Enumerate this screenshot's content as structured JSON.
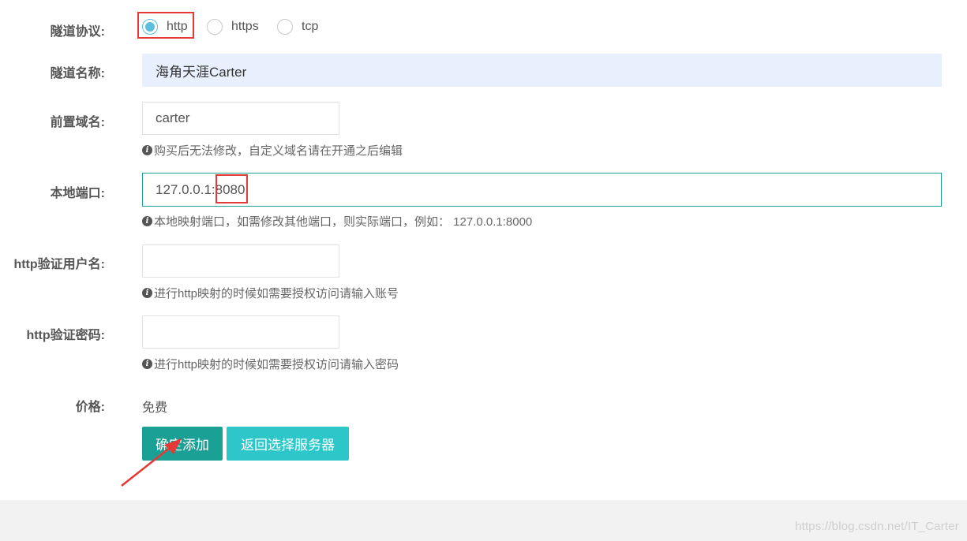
{
  "form": {
    "protocol": {
      "label": "隧道协议:",
      "options": [
        {
          "label": "http",
          "checked": true
        },
        {
          "label": "https",
          "checked": false
        },
        {
          "label": "tcp",
          "checked": false
        }
      ]
    },
    "tunnel_name": {
      "label": "隧道名称:",
      "value": "海角天涯Carter"
    },
    "prefix_domain": {
      "label": "前置域名:",
      "value": "carter",
      "hint": "购买后无法修改，自定义域名请在开通之后编辑"
    },
    "local_port": {
      "label": "本地端口:",
      "value_prefix": "127.0.0.1:",
      "value_port": "8080",
      "hint": "本地映射端口，如需修改其他端口，则实际端口，例如： 127.0.0.1:8000"
    },
    "http_user": {
      "label": "http验证用户名:",
      "value": "",
      "hint": "进行http映射的时候如需要授权访问请输入账号"
    },
    "http_password": {
      "label": "http验证密码:",
      "value": "",
      "hint": "进行http映射的时候如需要授权访问请输入密码"
    },
    "price": {
      "label": "价格:",
      "value": "免费"
    }
  },
  "buttons": {
    "confirm": "确定添加",
    "back": "返回选择服务器"
  },
  "watermark": "https://blog.csdn.net/IT_Carter",
  "colors": {
    "primary": "#1aa094",
    "secondary": "#2ec7c9",
    "radio_checked": "#5bc0de",
    "annotation": "#e53935",
    "autofill_bg": "#e8f0fe"
  }
}
